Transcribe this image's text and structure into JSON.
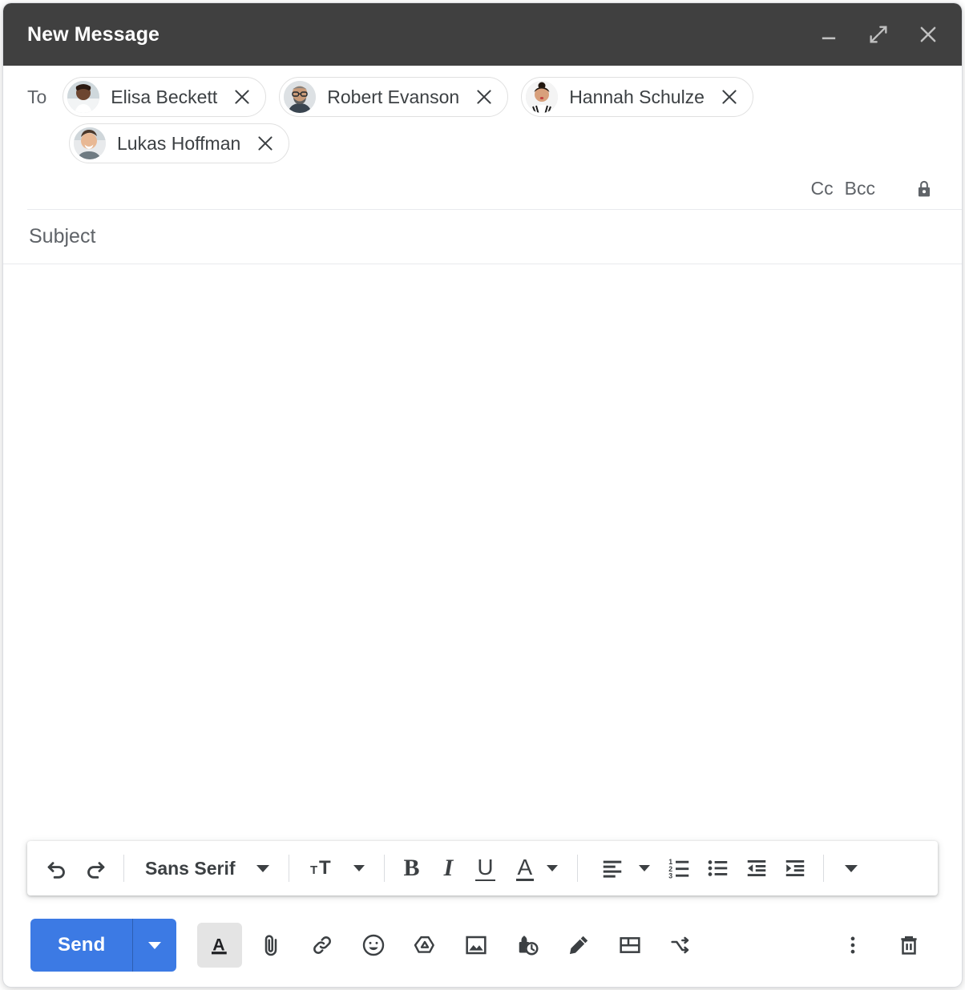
{
  "window": {
    "title": "New Message",
    "header_bg": "#404040",
    "controls": [
      {
        "name": "minimize-button",
        "icon": "minimize-icon",
        "label": "Minimize"
      },
      {
        "name": "expand-button",
        "icon": "expand-icon",
        "label": "Full screen"
      },
      {
        "name": "close-button",
        "icon": "close-icon",
        "label": "Save & close"
      }
    ]
  },
  "recipients": {
    "to_label": "To",
    "chips": [
      {
        "name": "Elisa Beckett",
        "avatar": "photo-woman-white-coat",
        "remove_label": "Remove"
      },
      {
        "name": "Robert Evanson",
        "avatar": "photo-man-glasses-beard",
        "remove_label": "Remove"
      },
      {
        "name": "Hannah Schulze",
        "avatar": "photo-woman-bun-stripes",
        "remove_label": "Remove"
      },
      {
        "name": "Lukas Hoffman",
        "avatar": "photo-man-smiling",
        "remove_label": "Remove"
      }
    ],
    "cc_label": "Cc",
    "bcc_label": "Bcc",
    "lock_icon": "lock-icon"
  },
  "subject": {
    "placeholder": "Subject",
    "value": ""
  },
  "body": {
    "value": "",
    "placeholder": ""
  },
  "format_toolbar": {
    "undo_label": "Undo",
    "redo_label": "Redo",
    "font_name": "Sans Serif",
    "font_size_label": "Size",
    "bold_label": "B",
    "italic_label": "I",
    "underline_label": "U",
    "text_color_label": "A",
    "align_label": "Align",
    "numbered_list_label": "Numbered list",
    "bulleted_list_label": "Bulleted list",
    "indent_less_label": "Indent less",
    "indent_more_label": "Indent more",
    "more_label": "More formatting options"
  },
  "actions": {
    "send_label": "Send",
    "send_color": "#3c7ae4",
    "send_options_label": "More send options",
    "items": [
      {
        "name": "formatting-options-button",
        "icon": "text-format-icon",
        "label": "Formatting options",
        "active": true
      },
      {
        "name": "attach-file-button",
        "icon": "paperclip-icon",
        "label": "Attach files",
        "active": false
      },
      {
        "name": "insert-link-button",
        "icon": "link-icon",
        "label": "Insert link",
        "active": false
      },
      {
        "name": "insert-emoji-button",
        "icon": "emoji-icon",
        "label": "Insert emoji",
        "active": false
      },
      {
        "name": "insert-drive-button",
        "icon": "drive-icon",
        "label": "Insert files using Drive",
        "active": false
      },
      {
        "name": "insert-photo-button",
        "icon": "photo-icon",
        "label": "Insert photo",
        "active": false
      },
      {
        "name": "confidential-mode-button",
        "icon": "lock-clock-icon",
        "label": "Toggle confidential mode",
        "active": false
      },
      {
        "name": "insert-signature-button",
        "icon": "pen-icon",
        "label": "Insert signature",
        "active": false
      },
      {
        "name": "insert-template-button",
        "icon": "layout-icon",
        "label": "Insert template",
        "active": false
      },
      {
        "name": "mail-merge-button",
        "icon": "shuffle-arrow-icon",
        "label": "Mail merge",
        "active": false
      }
    ],
    "more_options_label": "More options",
    "discard_label": "Discard draft"
  }
}
